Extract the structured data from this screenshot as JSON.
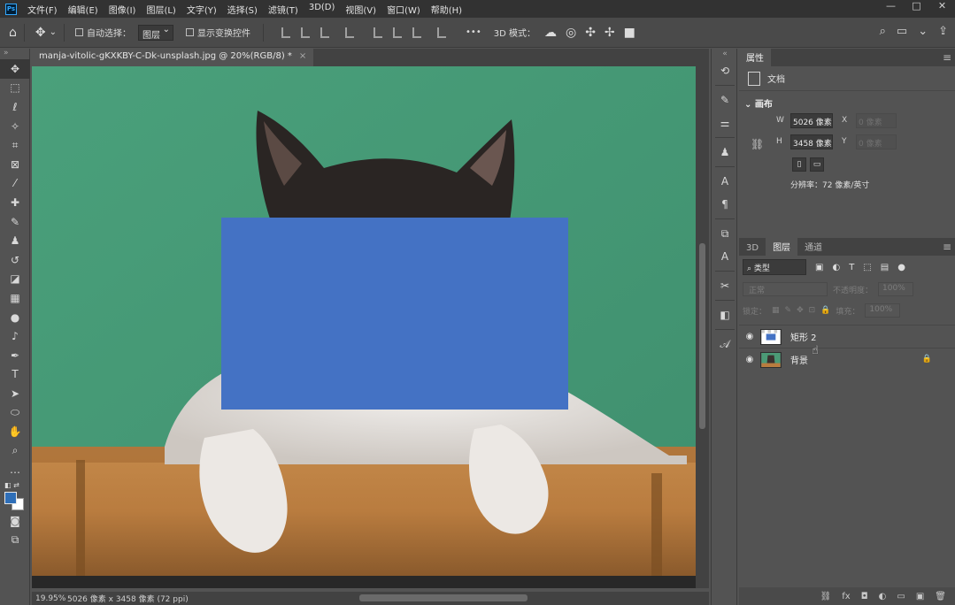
{
  "app": {
    "logo": "Ps",
    "menus": [
      "文件(F)",
      "编辑(E)",
      "图像(I)",
      "图层(L)",
      "文字(Y)",
      "选择(S)",
      "滤镜(T)",
      "3D(D)",
      "视图(V)",
      "窗口(W)",
      "帮助(H)"
    ],
    "window_controls": [
      "—",
      "□",
      "✕"
    ]
  },
  "options": {
    "auto_select_label": "自动选择：",
    "layer_select_value": "图层",
    "show_transform_label": "显示变换控件",
    "more": "•••",
    "mode_3d_label": "3D 模式："
  },
  "document": {
    "tab_title": "manja-vitolic-gKXKBY-C-Dk-unsplash.jpg @ 20%(RGB/8) *",
    "tab_close": "×",
    "zoom": "19.95%",
    "info": "5026 像素 x 3458 像素 (72 ppi)",
    "rect_color": "#4472c4",
    "wall_color": "#4b9a76"
  },
  "colors": {
    "foreground": "#2f6fb8",
    "background": "#ffffff"
  },
  "properties": {
    "tab": "属性",
    "doc_label": "文档",
    "section": "画布",
    "width_label": "W",
    "width_value": "5026 像素",
    "height_label": "H",
    "height_value": "3458 像素",
    "x_label": "X",
    "x_placeholder": "0 像素",
    "y_label": "Y",
    "y_placeholder": "0 像素",
    "resolution": "分辨率：72 像素/英寸"
  },
  "layers_panel": {
    "tabs": [
      "3D",
      "图层",
      "通道"
    ],
    "kind": "类型",
    "blend_mode": "正常",
    "opacity_label": "不透明度：",
    "opacity_value": "100%",
    "lock_label": "锁定：",
    "fill_label": "填充：",
    "fill_value": "100%",
    "layers": [
      {
        "name": "矩形 2"
      },
      {
        "name": "背景"
      }
    ],
    "footer": [
      "⛓",
      "fx",
      "◘",
      "◐",
      "▭",
      "▣",
      "🗑"
    ]
  }
}
